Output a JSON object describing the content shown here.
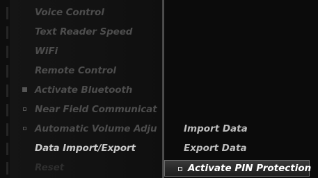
{
  "left_menu": {
    "items": [
      {
        "label": "Voice Control",
        "mark": "none"
      },
      {
        "label": "Text Reader Speed",
        "mark": "none"
      },
      {
        "label": "WiFi",
        "mark": "none"
      },
      {
        "label": "Remote Control",
        "mark": "none"
      },
      {
        "label": "Activate Bluetooth",
        "mark": "checked"
      },
      {
        "label": "Near Field Communicat",
        "mark": "unchecked"
      },
      {
        "label": "Automatic Volume Adju",
        "mark": "unchecked"
      },
      {
        "label": "Data Import/Export",
        "mark": "none"
      },
      {
        "label": "Reset",
        "mark": "none"
      }
    ]
  },
  "right_menu": {
    "items": [
      {
        "label": "Import Data"
      },
      {
        "label": "Export Data"
      },
      {
        "label": "Activate PIN Protection",
        "mark": "unchecked"
      }
    ]
  },
  "colors": {
    "background": "#0b0b0b",
    "active_text": "#c9c9c9",
    "dim_text": "#4d4d4d",
    "selected_bar": "#2e2e2e"
  }
}
